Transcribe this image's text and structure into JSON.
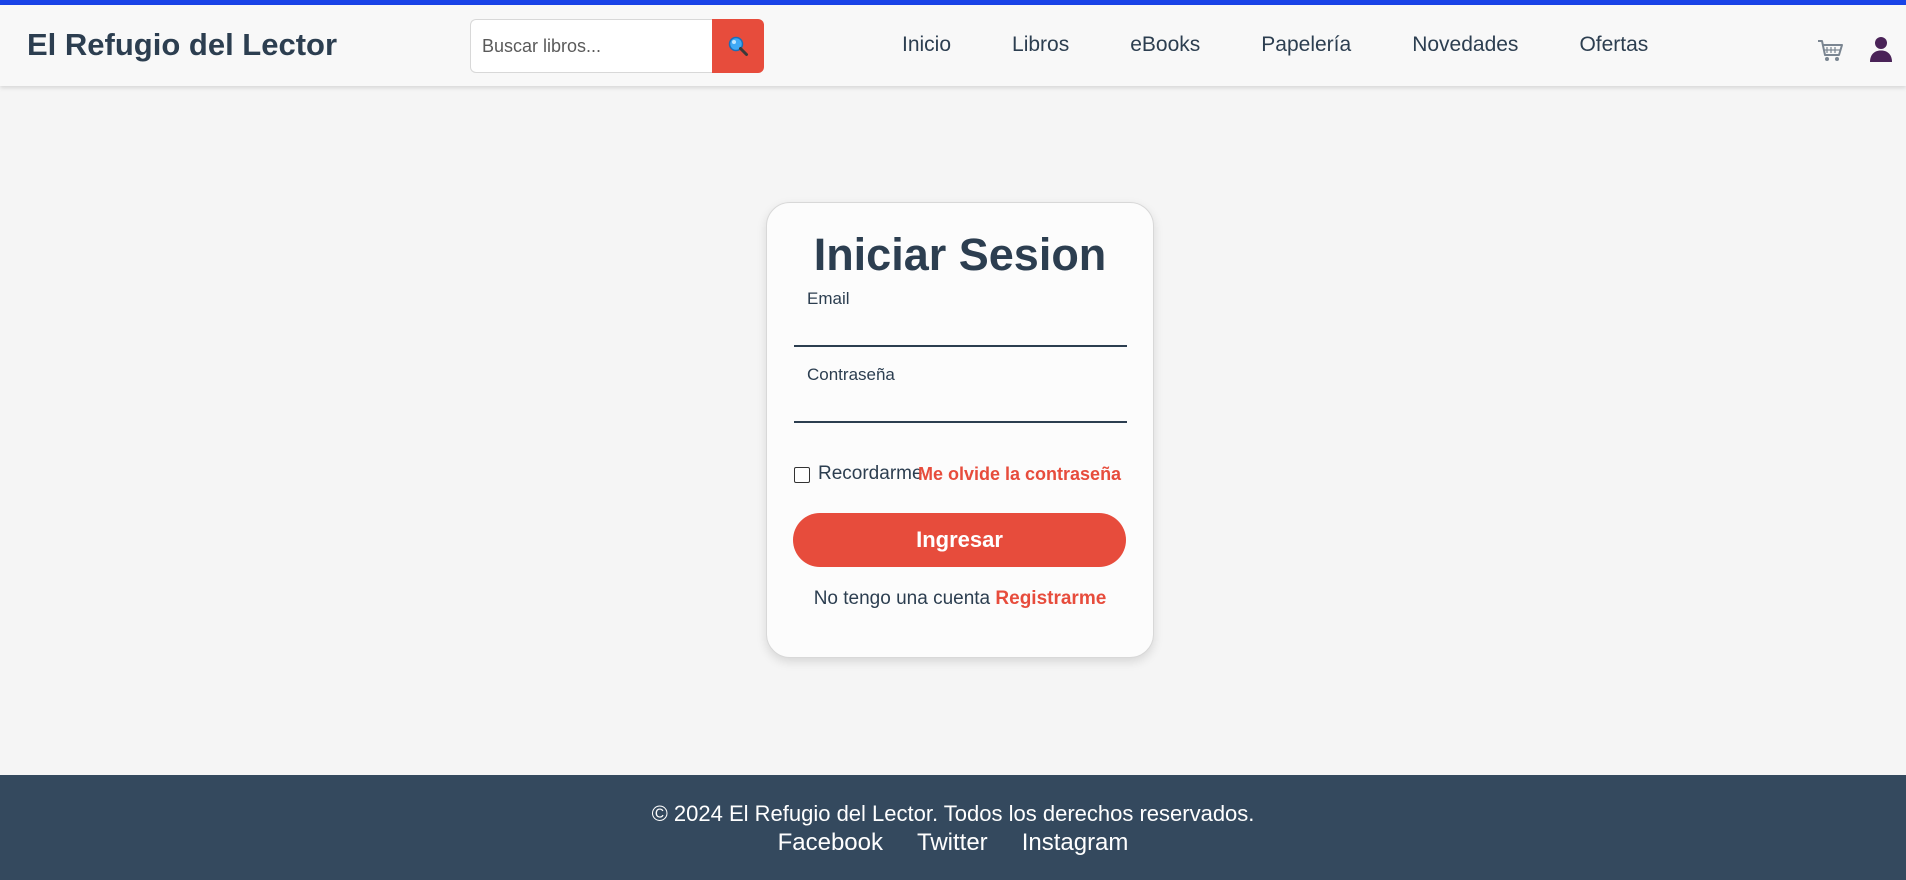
{
  "header": {
    "brand": "El Refugio del Lector",
    "search": {
      "placeholder": "Buscar libros...",
      "value": ""
    },
    "nav": [
      "Inicio",
      "Libros",
      "eBooks",
      "Papelería",
      "Novedades",
      "Ofertas"
    ],
    "icons": {
      "search": "search-icon",
      "cart": "cart-icon",
      "user": "user-icon"
    }
  },
  "login": {
    "title": "Iniciar Sesion",
    "email_label": "Email",
    "password_label": "Contraseña",
    "remember_label": "Recordarme",
    "remember_checked": false,
    "forgot_link": "Me olvide la contraseña",
    "submit_label": "Ingresar",
    "no_account_text": "No tengo una cuenta",
    "register_link": "Registrarme"
  },
  "footer": {
    "copyright": "© 2024 El Refugio del Lector. Todos los derechos reservados.",
    "social": [
      "Facebook",
      "Twitter",
      "Instagram"
    ]
  },
  "colors": {
    "accent": "#e74c3c",
    "text": "#2c3e50",
    "footer_bg": "#34495e",
    "top_line": "#1a44e8",
    "page_bg": "#f5f5f5"
  }
}
